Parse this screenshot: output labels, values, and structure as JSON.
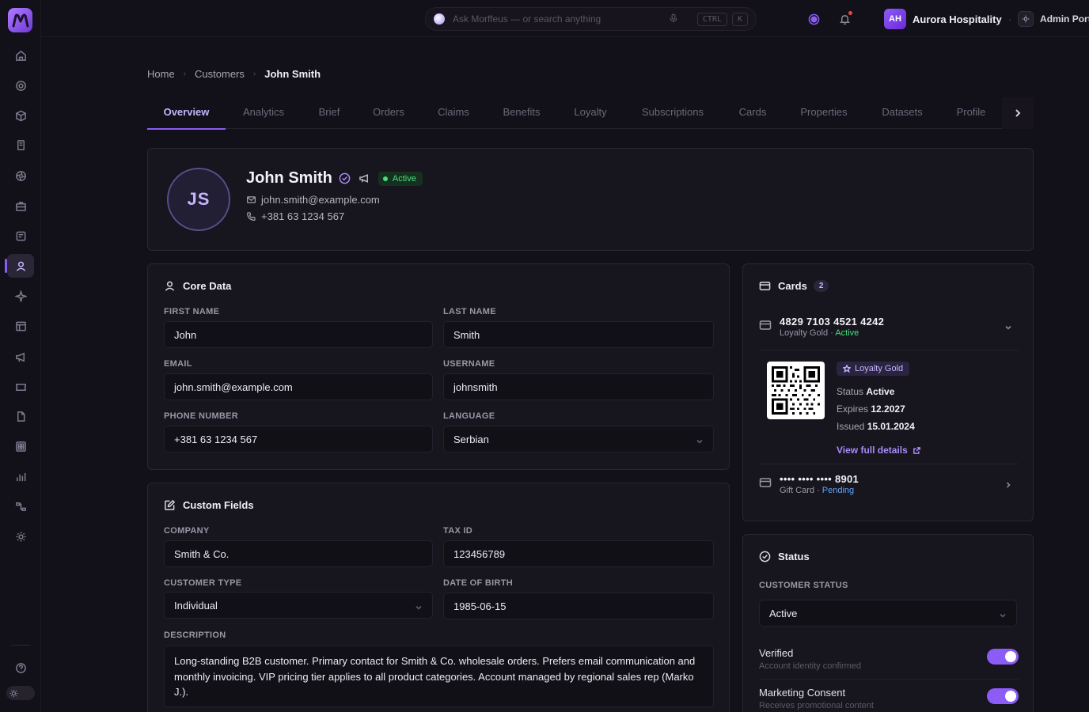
{
  "topbar": {
    "search_placeholder": "Ask Morffeus — or search anything",
    "kbd_ctrl": "CTRL",
    "kbd_k": "K",
    "org_initials": "AH",
    "org_name": "Aurora Hospitality",
    "separator": "·",
    "portal_name": "Admin Portal"
  },
  "breadcrumb": [
    "Home",
    "Customers",
    "John Smith"
  ],
  "tabs": [
    "Overview",
    "Analytics",
    "Brief",
    "Orders",
    "Claims",
    "Benefits",
    "Loyalty",
    "Subscriptions",
    "Cards",
    "Properties",
    "Datasets",
    "Profile"
  ],
  "profile": {
    "initials": "JS",
    "name": "John Smith",
    "status": "Active",
    "email": "john.smith@example.com",
    "phone": "+381 63 1234 567"
  },
  "core_data": {
    "title": "Core Data",
    "first_name_label": "FIRST NAME",
    "first_name": "John",
    "last_name_label": "LAST NAME",
    "last_name": "Smith",
    "email_label": "EMAIL",
    "email": "john.smith@example.com",
    "username_label": "USERNAME",
    "username": "johnsmith",
    "phone_label": "PHONE NUMBER",
    "phone": "+381 63 1234 567",
    "language_label": "LANGUAGE",
    "language": "Serbian"
  },
  "custom_fields": {
    "title": "Custom Fields",
    "company_label": "COMPANY",
    "company": "Smith & Co.",
    "tax_id_label": "TAX ID",
    "tax_id": "123456789",
    "customer_type_label": "CUSTOMER TYPE",
    "customer_type": "Individual",
    "dob_label": "DATE OF BIRTH",
    "dob": "1985-06-15",
    "description_label": "DESCRIPTION",
    "description": "Long-standing B2B customer. Primary contact for Smith & Co. wholesale orders. Prefers email communication and monthly invoicing. VIP pricing tier applies to all product categories. Account managed by regional sales rep (Marko J.)."
  },
  "cards": {
    "title": "Cards",
    "count": "2",
    "items": [
      {
        "number": "4829 7103 4521 4242",
        "type": "Loyalty Gold",
        "sep": " · ",
        "status": "Active"
      },
      {
        "number": "•••• •••• •••• 8901",
        "type": "Gift Card",
        "sep": " · ",
        "status": "Pending"
      }
    ],
    "detail": {
      "tier": "Loyalty Gold",
      "status_label": "Status",
      "status": "Active",
      "expires_label": "Expires",
      "expires": "12.2027",
      "issued_label": "Issued",
      "issued": "15.01.2024",
      "link": "View full details"
    }
  },
  "status": {
    "title": "Status",
    "customer_status_label": "CUSTOMER STATUS",
    "customer_status": "Active",
    "toggles": [
      {
        "title": "Verified",
        "subtitle": "Account identity confirmed",
        "on": true
      },
      {
        "title": "Marketing Consent",
        "subtitle": "Receives promotional content",
        "on": true
      }
    ]
  },
  "colors": {
    "accent": "#8b5cf6",
    "success": "#4ade80",
    "pending": "#60a5fa",
    "background": "#121018",
    "panel": "#17151d"
  },
  "icons": [
    "home-icon",
    "target-icon",
    "box-icon",
    "document-icon",
    "aperture-icon",
    "briefcase-icon",
    "list-icon",
    "user-icon",
    "sparkle-icon",
    "table-icon",
    "megaphone-icon",
    "ticket-icon",
    "file-icon",
    "grid-icon",
    "bar-chart-icon",
    "flow-icon",
    "settings-icon",
    "help-icon"
  ]
}
